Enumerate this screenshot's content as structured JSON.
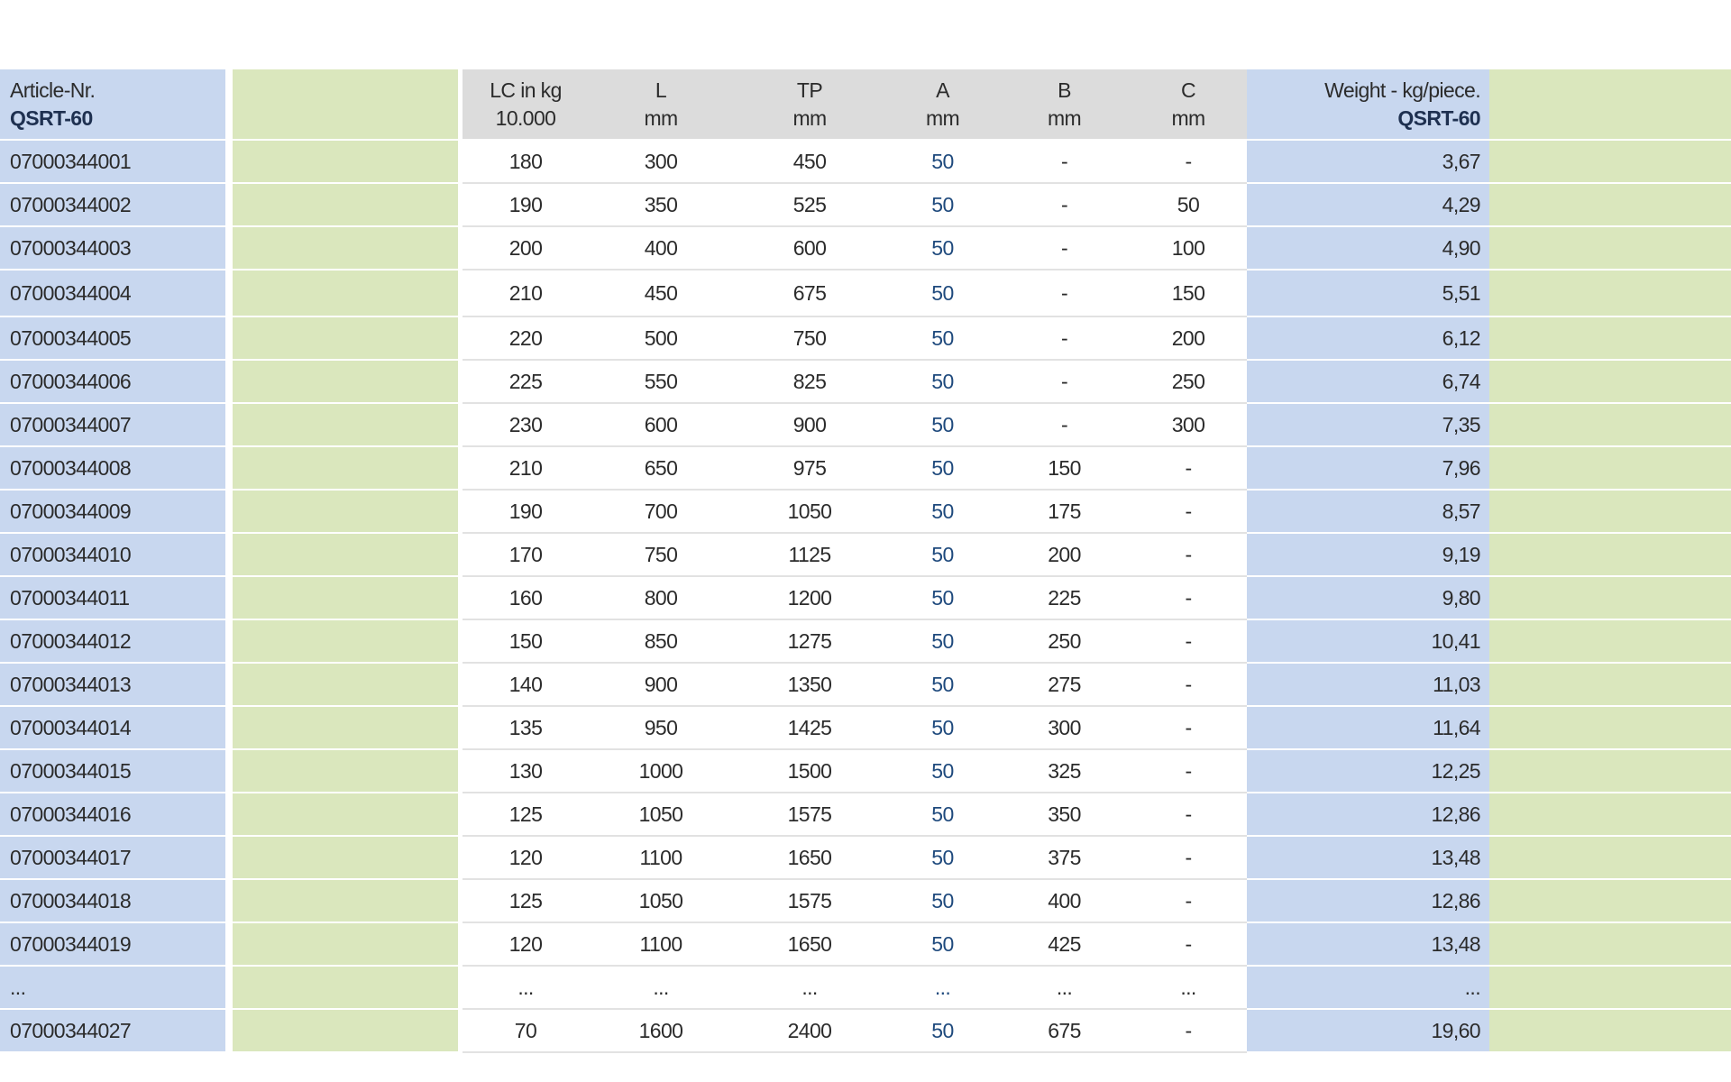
{
  "header": {
    "article_label": "Article-Nr.",
    "article_sub": "QSRT-60",
    "lc_label": "LC in kg",
    "lc_sub": "10.000",
    "l_label": "L",
    "l_unit": "mm",
    "tp_label": "TP",
    "tp_unit": "mm",
    "a_label": "A",
    "a_unit": "mm",
    "b_label": "B",
    "b_unit": "mm",
    "c_label": "C",
    "c_unit": "mm",
    "weight_label": "Weight - kg/piece.",
    "weight_sub": "QSRT-60"
  },
  "rows": [
    {
      "article": "07000344001",
      "lc": "180",
      "l": "300",
      "tp": "450",
      "a": "50",
      "b": "-",
      "c": "-",
      "weight": "3,67"
    },
    {
      "article": "07000344002",
      "lc": "190",
      "l": "350",
      "tp": "525",
      "a": "50",
      "b": "-",
      "c": "50",
      "weight": "4,29"
    },
    {
      "article": "07000344003",
      "lc": "200",
      "l": "400",
      "tp": "600",
      "a": "50",
      "b": "-",
      "c": "100",
      "weight": "4,90"
    },
    {
      "article": "07000344004",
      "lc": "210",
      "l": "450",
      "tp": "675",
      "a": "50",
      "b": "-",
      "c": "150",
      "weight": "5,51"
    },
    {
      "article": "07000344005",
      "lc": "220",
      "l": "500",
      "tp": "750",
      "a": "50",
      "b": "-",
      "c": "200",
      "weight": "6,12"
    },
    {
      "article": "07000344006",
      "lc": "225",
      "l": "550",
      "tp": "825",
      "a": "50",
      "b": "-",
      "c": "250",
      "weight": "6,74"
    },
    {
      "article": "07000344007",
      "lc": "230",
      "l": "600",
      "tp": "900",
      "a": "50",
      "b": "-",
      "c": "300",
      "weight": "7,35"
    },
    {
      "article": "07000344008",
      "lc": "210",
      "l": "650",
      "tp": "975",
      "a": "50",
      "b": "150",
      "c": "-",
      "weight": "7,96"
    },
    {
      "article": "07000344009",
      "lc": "190",
      "l": "700",
      "tp": "1050",
      "a": "50",
      "b": "175",
      "c": "-",
      "weight": "8,57"
    },
    {
      "article": "07000344010",
      "lc": "170",
      "l": "750",
      "tp": "1125",
      "a": "50",
      "b": "200",
      "c": "-",
      "weight": "9,19"
    },
    {
      "article": "07000344011",
      "lc": "160",
      "l": "800",
      "tp": "1200",
      "a": "50",
      "b": "225",
      "c": "-",
      "weight": "9,80"
    },
    {
      "article": "07000344012",
      "lc": "150",
      "l": "850",
      "tp": "1275",
      "a": "50",
      "b": "250",
      "c": "-",
      "weight": "10,41"
    },
    {
      "article": "07000344013",
      "lc": "140",
      "l": "900",
      "tp": "1350",
      "a": "50",
      "b": "275",
      "c": "-",
      "weight": "11,03"
    },
    {
      "article": "07000344014",
      "lc": "135",
      "l": "950",
      "tp": "1425",
      "a": "50",
      "b": "300",
      "c": "-",
      "weight": "11,64"
    },
    {
      "article": "07000344015",
      "lc": "130",
      "l": "1000",
      "tp": "1500",
      "a": "50",
      "b": "325",
      "c": "-",
      "weight": "12,25"
    },
    {
      "article": "07000344016",
      "lc": "125",
      "l": "1050",
      "tp": "1575",
      "a": "50",
      "b": "350",
      "c": "-",
      "weight": "12,86"
    },
    {
      "article": "07000344017",
      "lc": "120",
      "l": "1100",
      "tp": "1650",
      "a": "50",
      "b": "375",
      "c": "-",
      "weight": "13,48"
    },
    {
      "article": "07000344018",
      "lc": "125",
      "l": "1050",
      "tp": "1575",
      "a": "50",
      "b": "400",
      "c": "-",
      "weight": "12,86"
    },
    {
      "article": "07000344019",
      "lc": "120",
      "l": "1100",
      "tp": "1650",
      "a": "50",
      "b": "425",
      "c": "-",
      "weight": "13,48"
    },
    {
      "article": "...",
      "lc": "...",
      "l": "...",
      "tp": "...",
      "a": "...",
      "b": "...",
      "c": "...",
      "weight": "..."
    },
    {
      "article": "07000344027",
      "lc": "70",
      "l": "1600",
      "tp": "2400",
      "a": "50",
      "b": "675",
      "c": "-",
      "weight": "19,60"
    }
  ],
  "colors": {
    "article_column": "#c8d7ef",
    "green_column": "#dae7bd",
    "header_grey": "#dcdcdc",
    "weight_column": "#c8d7ef",
    "a_text": "#1f4a7d"
  }
}
